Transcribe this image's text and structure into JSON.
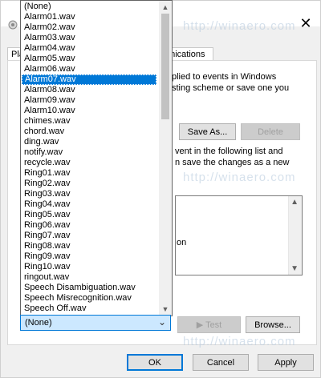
{
  "dialog": {
    "close_glyph": "✕",
    "tabs": {
      "playback_partial": "Pla",
      "communications_partial": "unications"
    },
    "description_lines": [
      "plied to events in Windows",
      "sting scheme or save one you"
    ],
    "save_as_label": "Save As...",
    "delete_label": "Delete",
    "program_text_lines": [
      "vent in the following list and",
      "n save the changes as a new"
    ],
    "events_item_fragment": "on",
    "test_label": "Test",
    "browse_label": "Browse...",
    "ok_label": "OK",
    "cancel_label": "Cancel",
    "apply_label": "Apply"
  },
  "sound_dropdown": {
    "selected_value": "(None)",
    "items": [
      "(None)",
      "Alarm01.wav",
      "Alarm02.wav",
      "Alarm03.wav",
      "Alarm04.wav",
      "Alarm05.wav",
      "Alarm06.wav",
      "Alarm07.wav",
      "Alarm08.wav",
      "Alarm09.wav",
      "Alarm10.wav",
      "chimes.wav",
      "chord.wav",
      "ding.wav",
      "notify.wav",
      "recycle.wav",
      "Ring01.wav",
      "Ring02.wav",
      "Ring03.wav",
      "Ring04.wav",
      "Ring05.wav",
      "Ring06.wav",
      "Ring07.wav",
      "Ring08.wav",
      "Ring09.wav",
      "Ring10.wav",
      "ringout.wav",
      "Speech Disambiguation.wav",
      "Speech Misrecognition.wav",
      "Speech Off.wav"
    ],
    "highlighted_index": 7
  },
  "watermark": "http://winaero.com"
}
